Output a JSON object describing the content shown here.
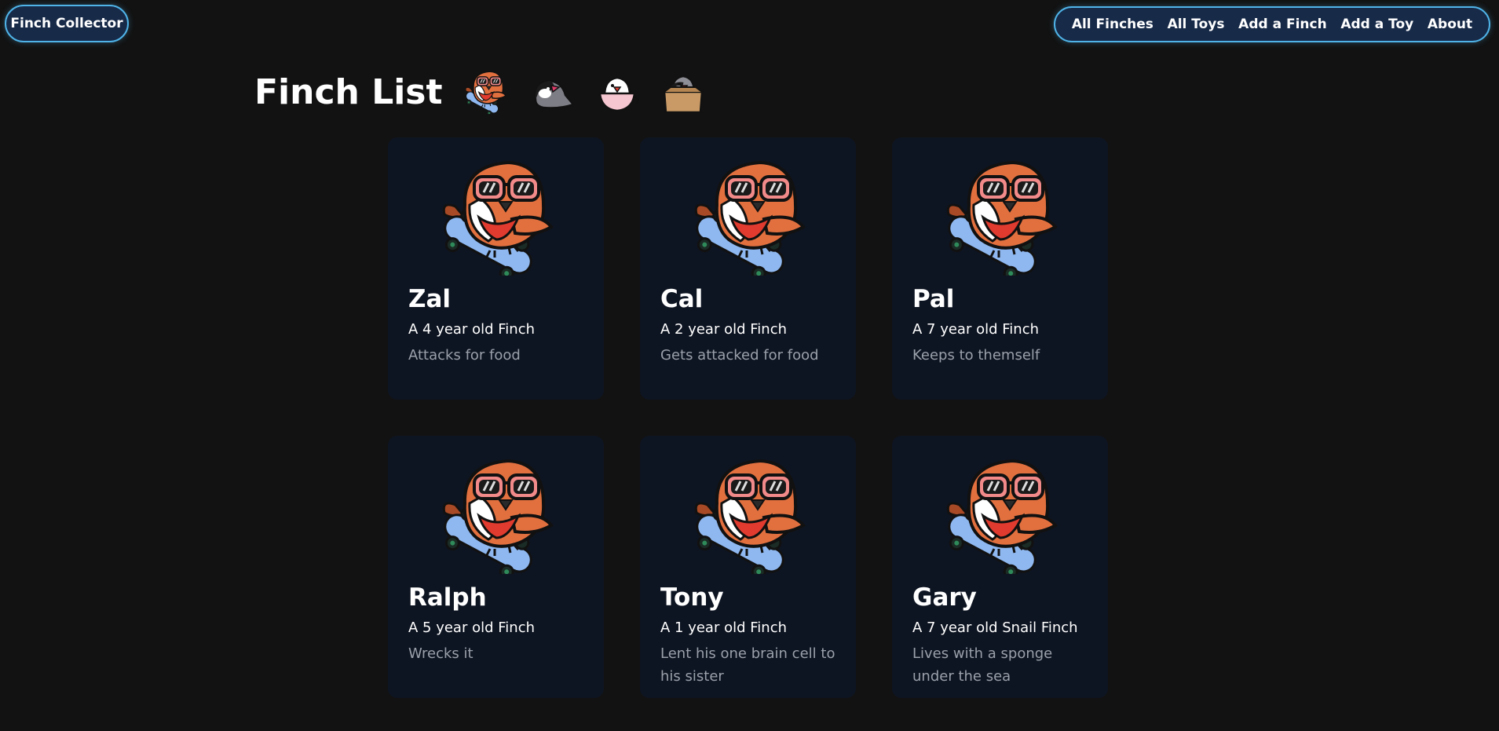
{
  "nav": {
    "home_label": "Finch Collector",
    "links": [
      {
        "label": "All Finches"
      },
      {
        "label": "All Toys"
      },
      {
        "label": "Add a Finch"
      },
      {
        "label": "Add a Toy"
      },
      {
        "label": "About"
      }
    ]
  },
  "header": {
    "title": "Finch List",
    "icons": [
      "cool-finch-icon",
      "java-sparrow-icon",
      "teacup-bird-icon",
      "box-bird-icon"
    ]
  },
  "finches": [
    {
      "name": "Zal",
      "age": "A 4 year old Finch",
      "description": "Attacks for food"
    },
    {
      "name": "Cal",
      "age": "A 2 year old Finch",
      "description": "Gets attacked for food"
    },
    {
      "name": "Pal",
      "age": "A 7 year old Finch",
      "description": "Keeps to themself"
    },
    {
      "name": "Ralph",
      "age": "A 5 year old Finch",
      "description": "Wrecks it"
    },
    {
      "name": "Tony",
      "age": "A 1 year old Finch",
      "description": "Lent his one brain cell to his sister"
    },
    {
      "name": "Gary",
      "age": "A 7 year old Snail Finch",
      "description": "Lives with a sponge under the sea"
    }
  ],
  "colors": {
    "background": "#121212",
    "card": "#0e1522",
    "accent": "#4fb3e8",
    "finch_orange": "#e2703f",
    "skateboard": "#8fb8f0"
  }
}
